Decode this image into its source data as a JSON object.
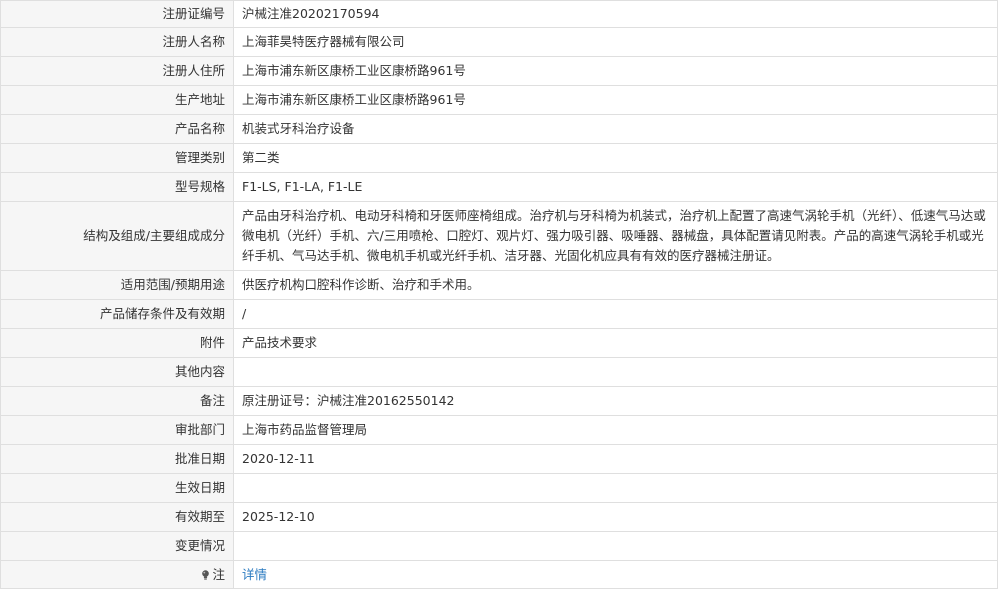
{
  "rows": [
    {
      "label": "注册证编号",
      "value": "沪械注准20202170594"
    },
    {
      "label": "注册人名称",
      "value": "上海菲昊特医疗器械有限公司"
    },
    {
      "label": "注册人住所",
      "value": "上海市浦东新区康桥工业区康桥路961号"
    },
    {
      "label": "生产地址",
      "value": "上海市浦东新区康桥工业区康桥路961号"
    },
    {
      "label": "产品名称",
      "value": "机装式牙科治疗设备"
    },
    {
      "label": "管理类别",
      "value": "第二类"
    },
    {
      "label": "型号规格",
      "value": "F1-LS, F1-LA, F1-LE"
    },
    {
      "label": "结构及组成/主要组成成分",
      "value": "产品由牙科治疗机、电动牙科椅和牙医师座椅组成。治疗机与牙科椅为机装式，治疗机上配置了高速气涡轮手机（光纤）、低速气马达或微电机（光纤）手机、六/三用喷枪、口腔灯、观片灯、强力吸引器、吸唾器、器械盘，具体配置请见附表。产品的高速气涡轮手机或光纤手机、气马达手机、微电机手机或光纤手机、洁牙器、光固化机应具有有效的医疗器械注册证。"
    },
    {
      "label": "适用范围/预期用途",
      "value": "供医疗机构口腔科作诊断、治疗和手术用。"
    },
    {
      "label": "产品储存条件及有效期",
      "value": "/"
    },
    {
      "label": "附件",
      "value": "产品技术要求"
    },
    {
      "label": "其他内容",
      "value": ""
    },
    {
      "label": "备注",
      "value": "原注册证号：沪械注准20162550142"
    },
    {
      "label": "审批部门",
      "value": "上海市药品监督管理局"
    },
    {
      "label": "批准日期",
      "value": "2020-12-11"
    },
    {
      "label": "生效日期",
      "value": ""
    },
    {
      "label": "有效期至",
      "value": "2025-12-10"
    },
    {
      "label": "变更情况",
      "value": ""
    },
    {
      "label": "注",
      "value": "详情",
      "icon": "lightbulb-icon"
    }
  ]
}
